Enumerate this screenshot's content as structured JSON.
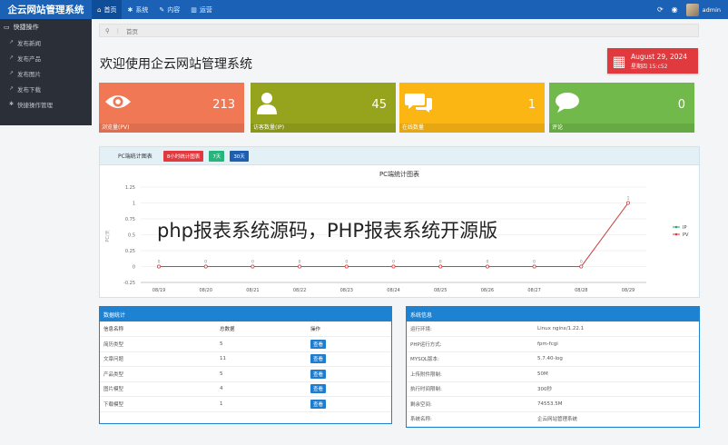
{
  "header": {
    "brand": "企云网站管理系统",
    "nav": [
      {
        "icon": "home-icon",
        "glyph": "⌂",
        "label": "首页"
      },
      {
        "icon": "gear-icon",
        "glyph": "✱",
        "label": "系统"
      },
      {
        "icon": "edit-icon",
        "glyph": "✎",
        "label": "内容"
      },
      {
        "icon": "chart-icon",
        "glyph": "▥",
        "label": "运营"
      }
    ],
    "username": "admin"
  },
  "sidebar": {
    "section": "快捷操作",
    "items": [
      {
        "label": "发布新闻"
      },
      {
        "label": "发布产品"
      },
      {
        "label": "发布图片"
      },
      {
        "label": "发布下载"
      },
      {
        "label": "快捷操作管理"
      }
    ]
  },
  "breadcrumb": {
    "label": "首页"
  },
  "page_title": "欢迎使用企云网站管理系统",
  "date": {
    "date": "August 29, 2024",
    "time": "星期四 15:c52"
  },
  "tiles": [
    {
      "icon": "eye-icon",
      "value": "213",
      "label": "浏览量(PV)",
      "color": "#f07855"
    },
    {
      "icon": "user-icon",
      "value": "45",
      "label": "访客数量(IP)",
      "color": "#96a31c"
    },
    {
      "icon": "comments-icon",
      "value": "1",
      "label": "在线数量",
      "color": "#fbb614"
    },
    {
      "icon": "comment-icon",
      "value": "0",
      "label": "评论",
      "color": "#70b94a"
    }
  ],
  "chart_panel": {
    "title": "PC端统计图表",
    "buttons": [
      "8小时统计图表",
      "7天",
      "30天"
    ]
  },
  "chart_data": {
    "type": "line",
    "title": "PC端统计图表",
    "ylabel": "PC/天",
    "categories": [
      "08/19",
      "08/20",
      "08/21",
      "08/22",
      "08/23",
      "08/24",
      "08/25",
      "08/26",
      "08/27",
      "08/28",
      "08/29"
    ],
    "y_ticks": [
      "1.25",
      "1",
      "0.75",
      "0.5",
      "0.25",
      "0",
      "-0.25"
    ],
    "ylim": [
      -0.25,
      1.25
    ],
    "series": [
      {
        "name": "IP",
        "color": "#2fa36b",
        "values": [
          0,
          0,
          0,
          0,
          0,
          0,
          0,
          0,
          0,
          0,
          1
        ]
      },
      {
        "name": "PV",
        "color": "#e0393e",
        "values": [
          0,
          0,
          0,
          0,
          0,
          0,
          0,
          0,
          0,
          0,
          1
        ]
      }
    ],
    "data_labels": [
      "0",
      "0",
      "0",
      "0",
      "0",
      "0",
      "0",
      "0",
      "0",
      "0",
      "1"
    ],
    "legend": "right"
  },
  "data_stats": {
    "title": "数据统计",
    "headers": [
      "信息名称",
      "总数据",
      "操作"
    ],
    "rows": [
      {
        "name": "简历类型",
        "count": "5",
        "action": "查看"
      },
      {
        "name": "文章问题",
        "count": "11",
        "action": "查看"
      },
      {
        "name": "产品类型",
        "count": "5",
        "action": "查看"
      },
      {
        "name": "图片模型",
        "count": "4",
        "action": "查看"
      },
      {
        "name": "下载模型",
        "count": "1",
        "action": "查看"
      }
    ]
  },
  "system_info": {
    "title": "系统信息",
    "rows": [
      {
        "key": "运行环境:",
        "value": "Linux nginx/1.22.1"
      },
      {
        "key": "PHP运行方式:",
        "value": "fpm-fcgi"
      },
      {
        "key": "MYSQL版本:",
        "value": "5.7.40-log"
      },
      {
        "key": "上传附件限制:",
        "value": "50M"
      },
      {
        "key": "执行时间限制:",
        "value": "300秒"
      },
      {
        "key": "剩余空间:",
        "value": "74553.5M"
      },
      {
        "key": "系统名称:",
        "value": "企云网站管理系统"
      }
    ]
  },
  "overlay_text": "php报表系统源码，PHP报表系统开源版"
}
